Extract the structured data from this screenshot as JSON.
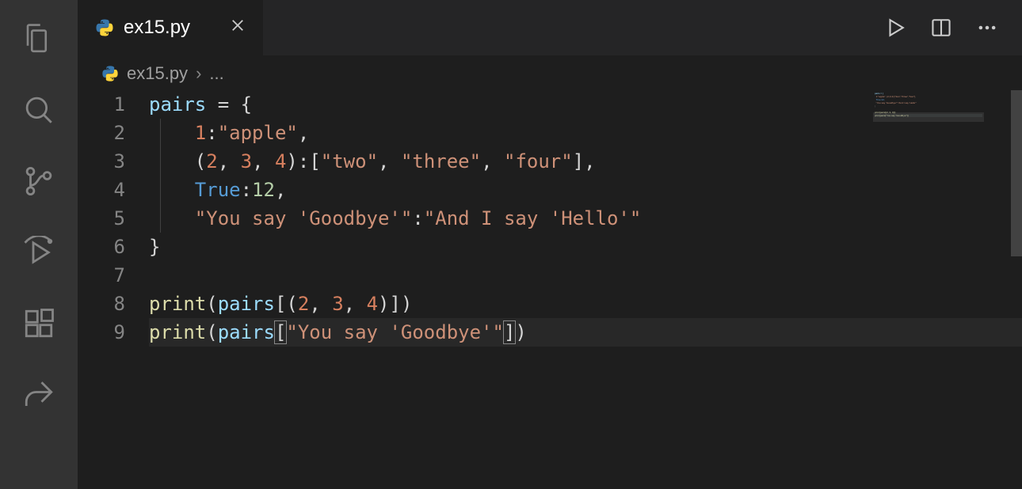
{
  "tab": {
    "filename": "ex15.py",
    "language_icon": "python-icon"
  },
  "breadcrumb": {
    "filename": "ex15.py",
    "suffix": "..."
  },
  "editor": {
    "line_numbers": [
      "1",
      "2",
      "3",
      "4",
      "5",
      "6",
      "7",
      "8",
      "9"
    ],
    "lines": {
      "l1": {
        "t0": "pairs",
        "t1": " = ",
        "t2": "{"
      },
      "l2": {
        "indent": "    ",
        "t0": "1",
        "t1": ":",
        "t2": "\"apple\"",
        "t3": ","
      },
      "l3": {
        "indent": "    ",
        "t0": "(",
        "t1": "2",
        "t2": ", ",
        "t3": "3",
        "t4": ", ",
        "t5": "4",
        "t6": ")",
        "t7": ":",
        "t8": "[",
        "t9": "\"two\"",
        "t10": ", ",
        "t11": "\"three\"",
        "t12": ", ",
        "t13": "\"four\"",
        "t14": "]",
        "t15": ","
      },
      "l4": {
        "indent": "    ",
        "t0": "True",
        "t1": ":",
        "t2": "12",
        "t3": ","
      },
      "l5": {
        "indent": "    ",
        "t0": "\"You say 'Goodbye'\"",
        "t1": ":",
        "t2": "\"And I say 'Hello'\""
      },
      "l6": {
        "t0": "}"
      },
      "l7": {
        "t0": ""
      },
      "l8": {
        "t0": "print",
        "t1": "(",
        "t2": "pairs",
        "t3": "[",
        "t4": "(",
        "t5": "2",
        "t6": ", ",
        "t7": "3",
        "t8": ", ",
        "t9": "4",
        "t10": ")",
        "t11": "]",
        "t12": ")"
      },
      "l9": {
        "t0": "print",
        "t1": "(",
        "t2": "pairs",
        "t3": "[",
        "t4": "\"You say 'Goodbye'\"",
        "t5": "]",
        "t6": ")"
      }
    }
  },
  "icons": {
    "explorer": "explorer-icon",
    "search": "search-icon",
    "scm": "source-control-icon",
    "debug": "debug-icon",
    "extensions": "extensions-icon",
    "liveshare": "liveshare-icon",
    "run": "run-icon",
    "split": "split-editor-icon",
    "more": "more-icon",
    "close": "close-icon"
  }
}
